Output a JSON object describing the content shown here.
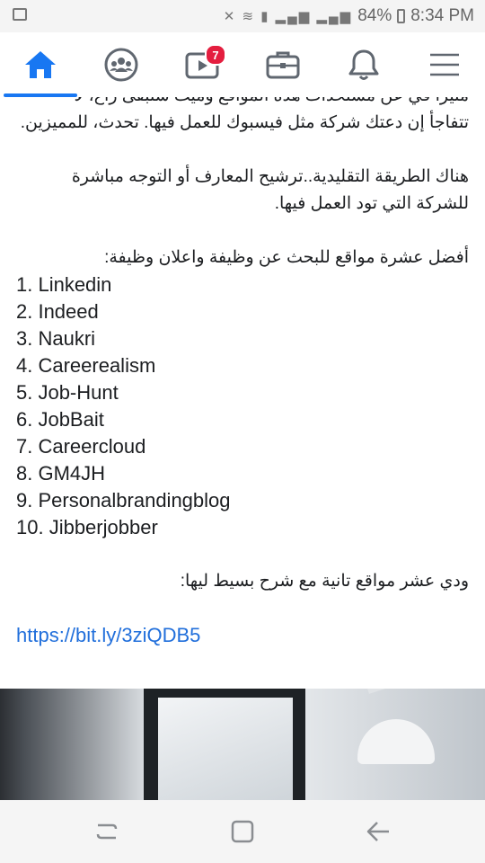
{
  "status_bar": {
    "battery": "84%",
    "time": "8:34 PM"
  },
  "nav": {
    "items": [
      {
        "icon": "home-icon",
        "active": true
      },
      {
        "icon": "groups-icon"
      },
      {
        "icon": "watch-icon",
        "badge": "7"
      },
      {
        "icon": "marketplace-icon"
      },
      {
        "icon": "bell-icon"
      },
      {
        "icon": "menu-icon"
      }
    ],
    "accent_color": "#1877f2",
    "badge_color": "#e41e3f"
  },
  "post": {
    "cut_line": "مثيرا في عن مستحدات هذه المواقع وميث ستبقى راع، لا",
    "para1": "تتفاجأ إن دعتك شركة مثل فيسبوك للعمل فيها. تحدث، للمميزين.",
    "para2": "هناك الطريقة التقليدية..ترشيح المعارف أو التوجه مباشرة للشركة التي تود العمل فيها.",
    "list_heading": "أفضل عشرة مواقع للبحث عن وظيفة واعلان وظيفة:",
    "list": [
      "1. Linkedin",
      "2. Indeed",
      "3. Naukri",
      "4. Careerealism",
      "5. Job-Hunt",
      "6. JobBait",
      "7. Careercloud",
      "8. GM4JH",
      "9. Personalbrandingblog",
      "10. Jibberjobber"
    ],
    "para3": "ودي عشر مواقع تانية مع شرح بسيط ليها:",
    "link": "https://bit.ly/3ziQDB5",
    "link_color": "#216fdb"
  }
}
